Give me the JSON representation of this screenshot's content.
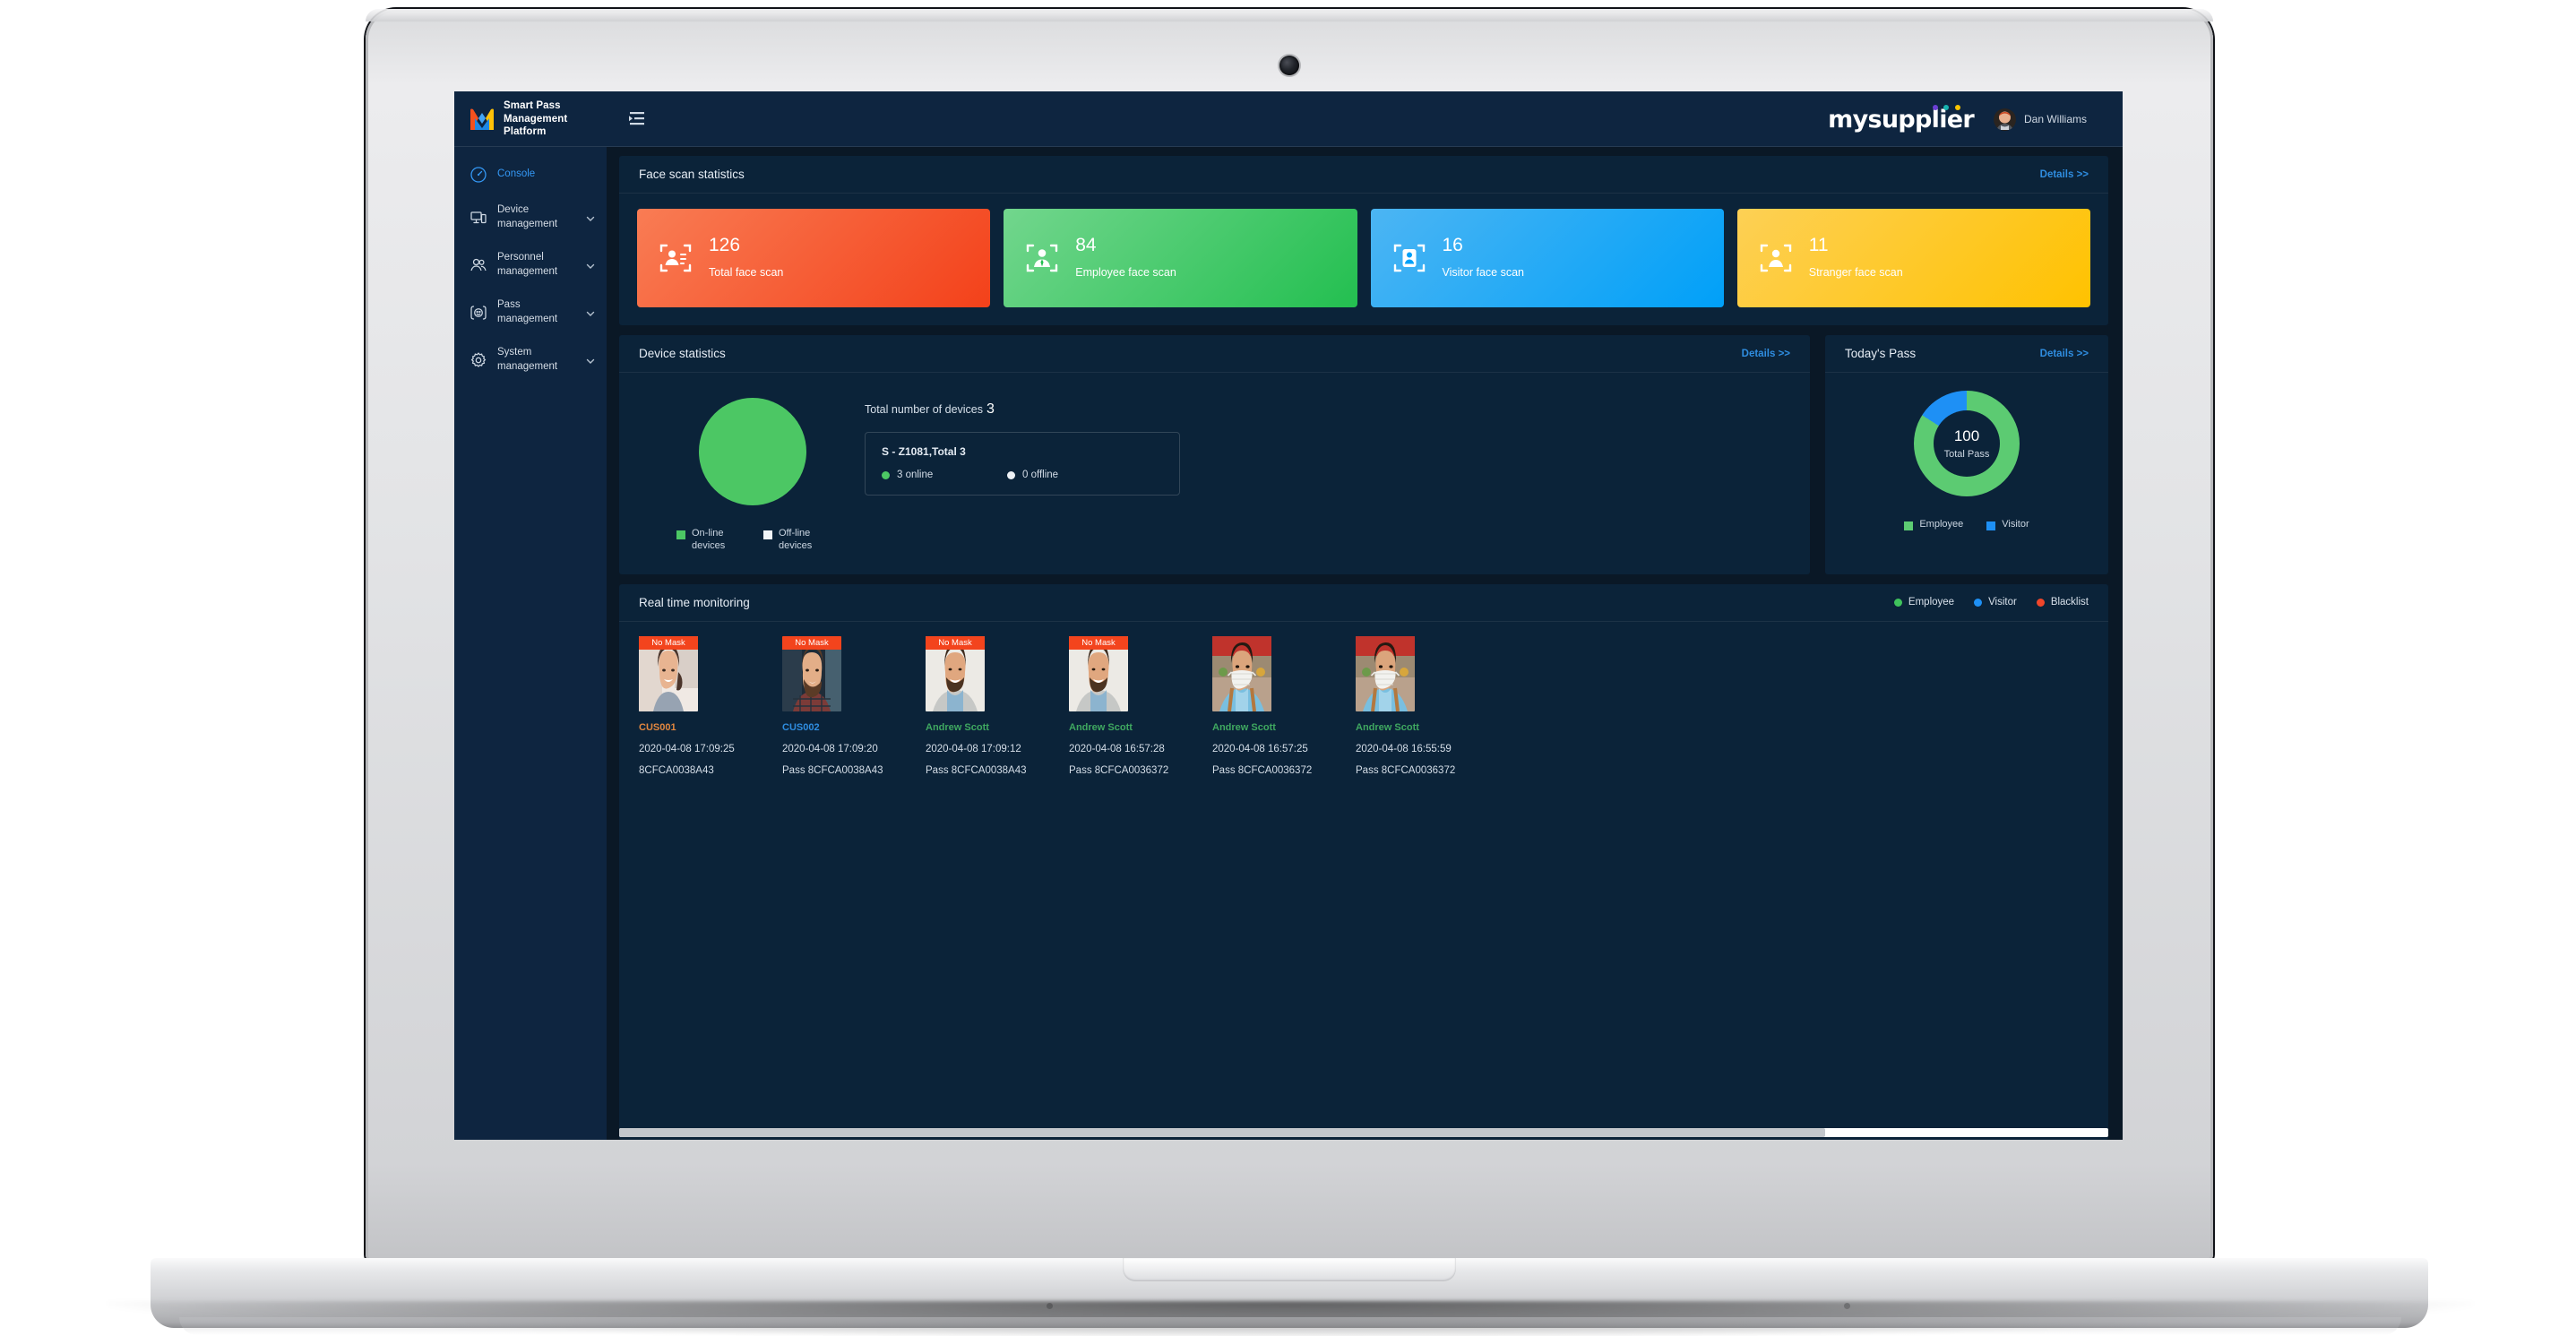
{
  "brand": {
    "title_line1": "Smart Pass",
    "title_line2": "Management Platform",
    "logo_icon": "m-logo-icon",
    "collapse_icon": "collapse-sidebar-icon"
  },
  "header": {
    "product_logo": "mysupplier",
    "user_name": "Dan Williams",
    "avatar_icon": "user-avatar"
  },
  "sidebar": {
    "items": [
      {
        "label": "Console",
        "icon": "dashboard-icon",
        "active": true,
        "expandable": false
      },
      {
        "label": "Device\nmanagement",
        "label_l1": "Device",
        "label_l2": "management",
        "icon": "device-icon",
        "active": false,
        "expandable": true
      },
      {
        "label": "Personnel\nmanagement",
        "label_l1": "Personnel",
        "label_l2": "management",
        "icon": "people-icon",
        "active": false,
        "expandable": true
      },
      {
        "label": "Pass\nmanagement",
        "label_l1": "Pass",
        "label_l2": "management",
        "icon": "face-pass-icon",
        "active": false,
        "expandable": true
      },
      {
        "label": "System\nmanagement",
        "label_l1": "System",
        "label_l2": "management",
        "icon": "gear-icon",
        "active": false,
        "expandable": true
      }
    ]
  },
  "face_scan": {
    "title": "Face scan statistics",
    "details_label": "Details >>",
    "cards": [
      {
        "value": "126",
        "label": "Total face scan",
        "icon": "face-scan-total-icon",
        "color_from": "#f96a4b",
        "color_to": "#f4471c"
      },
      {
        "value": "84",
        "label": "Employee face scan",
        "icon": "face-scan-employee-icon",
        "color_from": "#6bd089",
        "color_to": "#27c152"
      },
      {
        "value": "16",
        "label": "Visitor face scan",
        "icon": "face-scan-visitor-icon",
        "color_from": "#43aaf0",
        "color_to": "#00a1f7"
      },
      {
        "value": "11",
        "label": "Stranger face scan",
        "icon": "face-scan-stranger-icon",
        "color_from": "#fbc63f",
        "color_to": "#ffc300"
      }
    ]
  },
  "device_statistics": {
    "title": "Device statistics",
    "details_label": "Details >>",
    "total_label": "Total number of devices",
    "total_value": "3",
    "group": {
      "title": "S - Z1081,Total 3",
      "online_label": "3 online",
      "offline_label": "0 offline"
    },
    "legend": [
      {
        "label_l1": "On-line",
        "label_l2": "devices",
        "color": "#4cc764"
      },
      {
        "label_l1": "Off-line",
        "label_l2": "devices",
        "color": "#f2f5f8"
      }
    ]
  },
  "todays_pass": {
    "title": "Today's Pass",
    "details_label": "Details >>",
    "center_value": "100",
    "center_label": "Total Pass",
    "legend": [
      {
        "label": "Employee",
        "color": "#5ccb72"
      },
      {
        "label": "Visitor",
        "color": "#1e90f5"
      }
    ]
  },
  "real_time_monitoring": {
    "title": "Real time monitoring",
    "legend": [
      {
        "label": "Employee",
        "color": "#3fc35c"
      },
      {
        "label": "Visitor",
        "color": "#1e90f5"
      },
      {
        "label": "Blacklist",
        "color": "#f0462a"
      }
    ],
    "mask_tag": "No Mask",
    "cards": [
      {
        "name": "CUS001",
        "name_color": "#e2873f",
        "time": "2020-04-08 17:09:25",
        "pass": "8CFCA0038A43",
        "mask": false,
        "photo": "woman-smiling-photo"
      },
      {
        "name": "CUS002",
        "name_color": "#2f8de0",
        "time": "2020-04-08 17:09:20",
        "pass": "Pass 8CFCA0038A43",
        "mask": false,
        "photo": "bearded-man-plaid-photo"
      },
      {
        "name": "Andrew Scott",
        "name_color": "#3fa860",
        "time": "2020-04-08 17:09:12",
        "pass": "Pass 8CFCA0038A43",
        "mask": false,
        "photo": "man-grey-jacket-photo"
      },
      {
        "name": "Andrew Scott",
        "name_color": "#3fa860",
        "time": "2020-04-08 16:57:28",
        "pass": "Pass 8CFCA0036372",
        "mask": false,
        "photo": "man-grey-jacket-photo"
      },
      {
        "name": "Andrew Scott",
        "name_color": "#3fa860",
        "time": "2020-04-08 16:57:25",
        "pass": "Pass 8CFCA0036372",
        "mask": true,
        "photo": "masked-worker-photo"
      },
      {
        "name": "Andrew Scott",
        "name_color": "#3fa860",
        "time": "2020-04-08 16:55:59",
        "pass": "Pass 8CFCA0036372",
        "mask": true,
        "photo": "masked-worker-photo"
      }
    ]
  },
  "chart_data": [
    {
      "type": "pie",
      "title": "Device statistics",
      "categories": [
        "On-line devices",
        "Off-line devices"
      ],
      "values": [
        3,
        0
      ],
      "colors": [
        "#4cc764",
        "#f2f5f8"
      ],
      "legend": "bottom",
      "total": 3
    },
    {
      "type": "pie",
      "title": "Today's Pass",
      "subtitle": "100 Total Pass",
      "categories": [
        "Employee",
        "Visitor"
      ],
      "values": [
        84,
        16
      ],
      "colors": [
        "#5ccb72",
        "#1e90f5"
      ],
      "legend": "bottom",
      "total": 100,
      "donut": true
    },
    {
      "type": "bar",
      "title": "Face scan statistics",
      "categories": [
        "Total face scan",
        "Employee face scan",
        "Visitor face scan",
        "Stranger face scan"
      ],
      "values": [
        126,
        84,
        16,
        11
      ],
      "colors": [
        "#f4471c",
        "#27c152",
        "#00a1f7",
        "#ffc300"
      ],
      "xlabel": "",
      "ylabel": "",
      "ylim": [
        0,
        126
      ]
    }
  ],
  "scrollbar": {
    "thumb_percent": 81
  }
}
